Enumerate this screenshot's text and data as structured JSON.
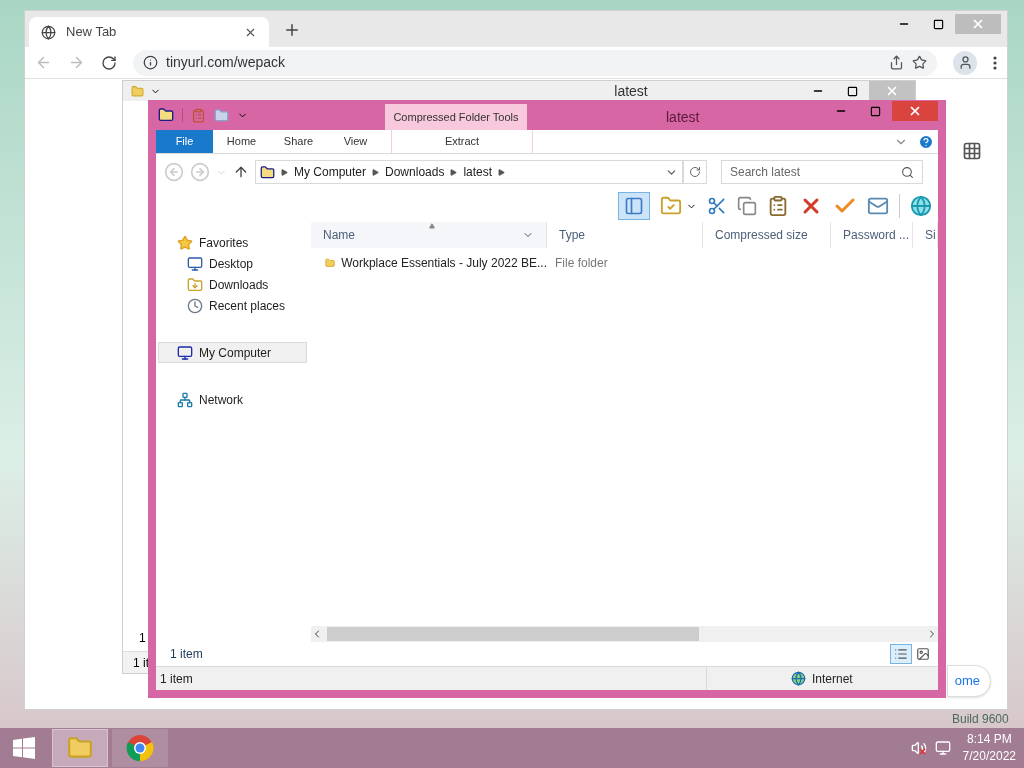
{
  "desktop": {
    "build_text": "Build 9600"
  },
  "browser": {
    "tabs": [
      {
        "label": "New Tab",
        "selected": true
      }
    ],
    "url": "tinyurl.com/wepack",
    "partial_button": "ome"
  },
  "back_window": {
    "title": "latest",
    "row_fragment": "1",
    "status": "1 it"
  },
  "explorer": {
    "title": "latest",
    "context_tab": "Compressed Folder Tools",
    "ribbon_tabs": [
      {
        "label": "File",
        "selected": true
      },
      {
        "label": "Home",
        "selected": false
      },
      {
        "label": "Share",
        "selected": false
      },
      {
        "label": "View",
        "selected": false
      },
      {
        "label": "Extract",
        "selected": false
      }
    ],
    "breadcrumb": [
      "My Computer",
      "Downloads",
      "latest"
    ],
    "search": {
      "placeholder": "Search latest"
    },
    "preview_pane_on": true,
    "nav": [
      {
        "label": "Favorites",
        "kind": "star",
        "selected": false,
        "children": [
          {
            "label": "Desktop",
            "kind": "desktop",
            "selected": false
          },
          {
            "label": "Downloads",
            "kind": "downloads",
            "selected": false
          },
          {
            "label": "Recent places",
            "kind": "recent",
            "selected": false
          }
        ]
      },
      {
        "label": "My Computer",
        "kind": "computer",
        "selected": true
      },
      {
        "label": "Network",
        "kind": "network",
        "selected": false
      }
    ],
    "columns": [
      {
        "label": "Name",
        "sorted": true
      },
      {
        "label": "Type",
        "sorted": false
      },
      {
        "label": "Compressed size",
        "sorted": false
      },
      {
        "label": "Password ...",
        "sorted": false
      },
      {
        "label": "Si",
        "sorted": false
      }
    ],
    "rows": [
      {
        "name": "Workplace Essentials - July 2022 BE...",
        "type": "File folder",
        "selected": false
      }
    ],
    "item_count": "1 item",
    "views": [
      {
        "kind": "details",
        "selected": true
      },
      {
        "kind": "thumbnails",
        "selected": false
      }
    ],
    "status": {
      "count": "1 item",
      "zone": "Internet"
    }
  },
  "taskbar": {
    "apps": [
      {
        "kind": "explorer",
        "active": true
      },
      {
        "kind": "chrome",
        "active": false
      }
    ],
    "volume_muted": true,
    "time": "8:14 PM",
    "date": "7/20/2022"
  }
}
